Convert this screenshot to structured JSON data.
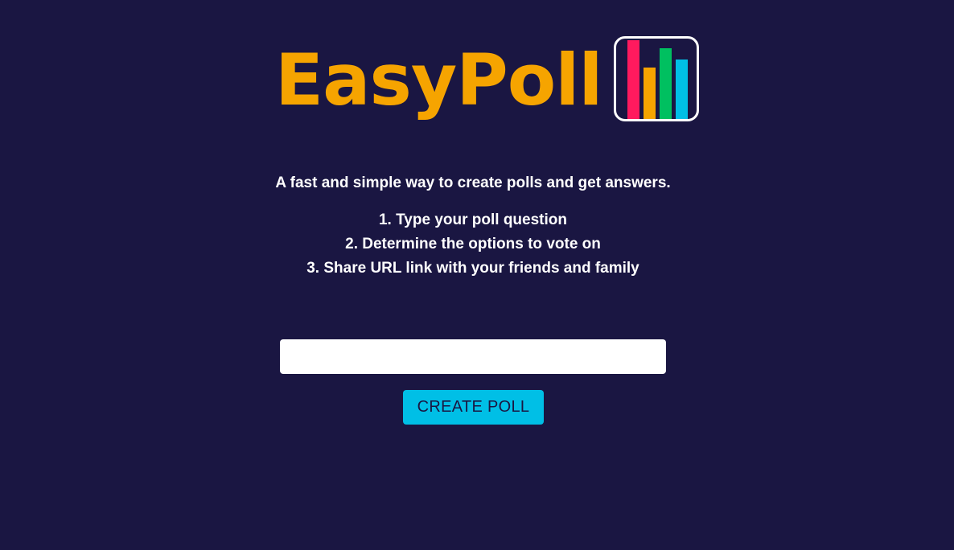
{
  "logo": {
    "text": "EasyPoll",
    "text_color": "#f6a400",
    "icon": "bar-chart-icon",
    "bars": [
      {
        "color": "#ff1a5e",
        "level": 1.0
      },
      {
        "color": "#f6a400",
        "level": 0.65
      },
      {
        "color": "#00c060",
        "level": 0.9
      },
      {
        "color": "#00bfe6",
        "level": 0.75
      }
    ]
  },
  "tagline": "A fast and simple way to create polls and get answers.",
  "steps": [
    "1. Type your poll question",
    "2. Determine the options to vote on",
    "3. Share URL link with your friends and family"
  ],
  "question_input": {
    "value": "",
    "placeholder": ""
  },
  "create_button": {
    "label": "CREATE POLL",
    "color": "#00bfe6"
  },
  "colors": {
    "background": "#1a1642",
    "text": "#ffffff"
  }
}
